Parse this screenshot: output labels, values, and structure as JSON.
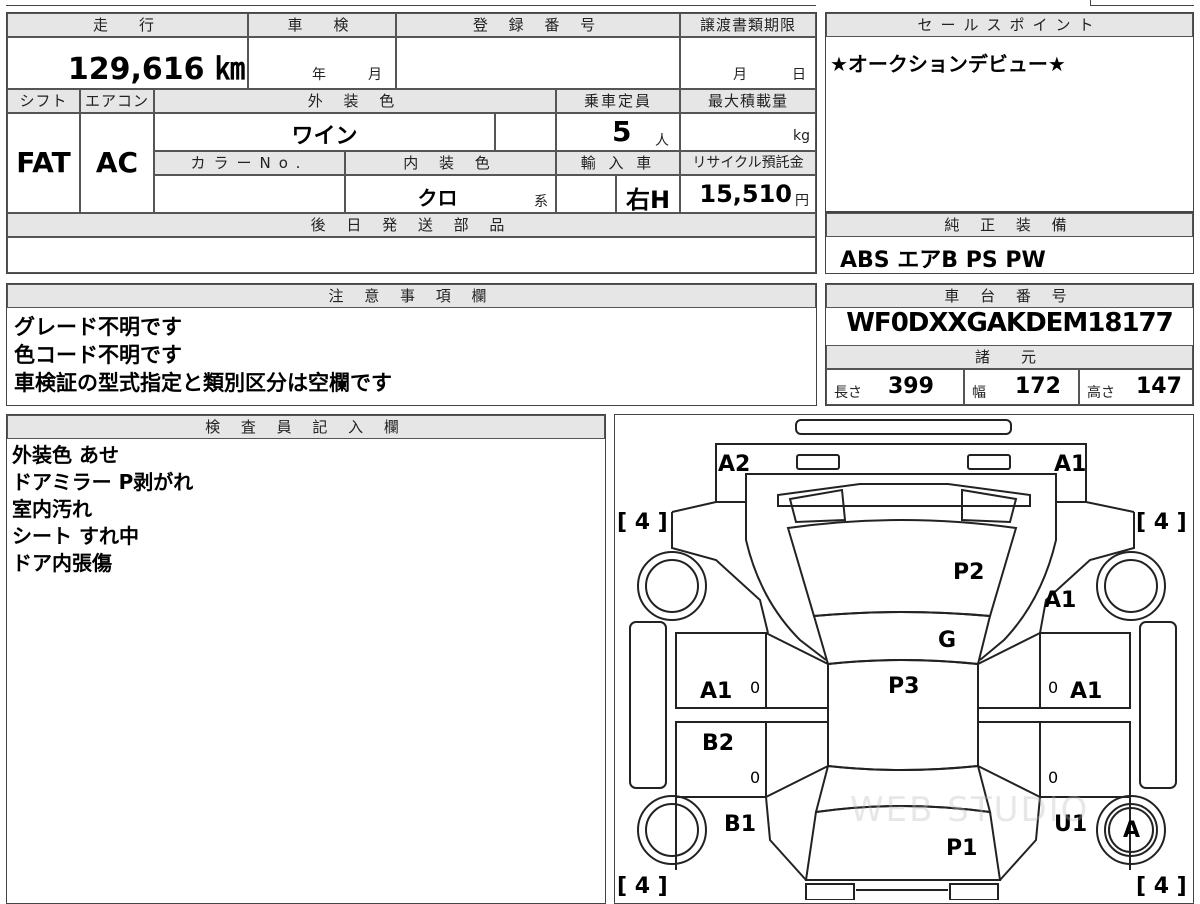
{
  "mileage": {
    "header": "走　行",
    "value": "129,616 ㎞"
  },
  "inspection": {
    "header": "車　検",
    "year_label": "年",
    "month_label": "月"
  },
  "registration": {
    "header": "登 録 番 号",
    "value": ""
  },
  "transfer": {
    "header": "譲渡書類期限",
    "month_label": "月",
    "day_label": "日"
  },
  "sales_point": {
    "header": "セールスポイント",
    "text": "★オークションデビュー★"
  },
  "shift": {
    "header": "シフト",
    "value": "FAT"
  },
  "aircon": {
    "header": "エアコン",
    "value": "AC"
  },
  "exterior_color": {
    "header": "外 装 色",
    "value": "ワイン"
  },
  "capacity": {
    "header": "乗車定員",
    "value": "5",
    "unit": "人"
  },
  "max_load": {
    "header": "最大積載量",
    "unit": "kg"
  },
  "color_no": {
    "header": "カラーNo.",
    "value": ""
  },
  "interior_color": {
    "header": "内 装 色",
    "value": "クロ",
    "suffix": "系"
  },
  "import": {
    "header": "輸 入 車",
    "value": "右H"
  },
  "recycle": {
    "header": "リサイクル預託金",
    "value": "15,510",
    "unit": "円"
  },
  "later_parts": {
    "header": "後 日 発 送 部 品",
    "value": ""
  },
  "standard_equipment": {
    "header": "純 正 装 備",
    "value": "ABS エアB PS PW"
  },
  "notes": {
    "header": "注 意 事 項 欄",
    "lines": [
      "グレード不明です",
      "色コード不明です",
      "車検証の型式指定と類別区分は空欄です"
    ]
  },
  "chassis": {
    "header": "車 台 番 号",
    "value": "WF0DXXGAKDEM18177"
  },
  "specs": {
    "header": "諸　元",
    "length_label": "長さ",
    "length": "399",
    "width_label": "幅",
    "width": "172",
    "height_label": "高さ",
    "height": "147"
  },
  "inspector": {
    "header": "検 査 員 記 入 欄",
    "lines": [
      "外装色 あせ",
      "ドアミラー P剥がれ",
      "室内汚れ",
      "シート すれ中",
      "ドア内張傷"
    ]
  },
  "diagram": {
    "marks": {
      "front_left": "A2",
      "front_right": "A1",
      "hood": "P2",
      "right_fender": "A1",
      "windshield": "G",
      "roof": "P3",
      "left_front_door": "A1",
      "right_front_door": "A1",
      "left_rear_door": "B2",
      "left_rear_quarter": "B1",
      "right_rear_quarter": "U1",
      "trunk": "P1",
      "right_rear_wheel": "A"
    },
    "tire_depths": [
      "[ 4 ]",
      "[ 4 ]",
      "[ 4 ]",
      "[ 4 ]"
    ],
    "zeros": [
      "0",
      "0",
      "0",
      "0"
    ],
    "watermark": "WEB STUDIO"
  }
}
